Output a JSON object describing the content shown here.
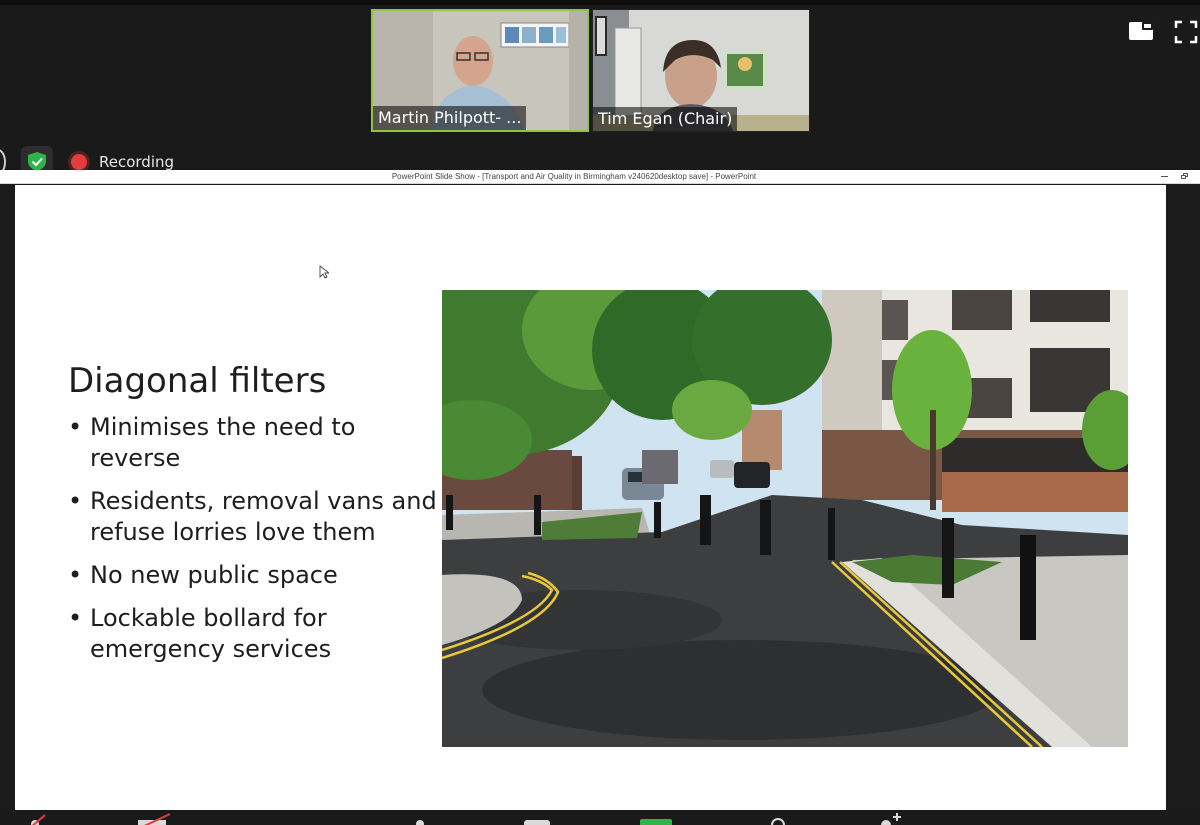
{
  "meeting": {
    "participants": [
      {
        "name": "Martin Philpott- ...",
        "active_speaker": true
      },
      {
        "name": "Tim Egan (Chair)",
        "active_speaker": false
      }
    ],
    "recording_label": "Recording",
    "view_controls": {
      "layout_icon": "speaker-view-icon",
      "fullscreen_icon": "fullscreen-icon"
    },
    "status_icons": [
      "security-shield-icon",
      "recording-dot-icon"
    ]
  },
  "window": {
    "title": "PowerPoint Slide Show - [Transport and Air Quality in Birmingham v240620desktop save] - PowerPoint"
  },
  "slide": {
    "title": "Diagonal filters",
    "bullets": [
      "Minimises the need to reverse",
      "Residents, removal vans and refuse lorries love them",
      "No new public space",
      "Lockable bollard for emergency services"
    ]
  },
  "colors": {
    "active_speaker_border": "#8ec549",
    "recording_dot": "#e23c3c",
    "security_shield": "#2fb34a",
    "meeting_background": "#1a1a1a",
    "slide_background": "#ffffff"
  }
}
